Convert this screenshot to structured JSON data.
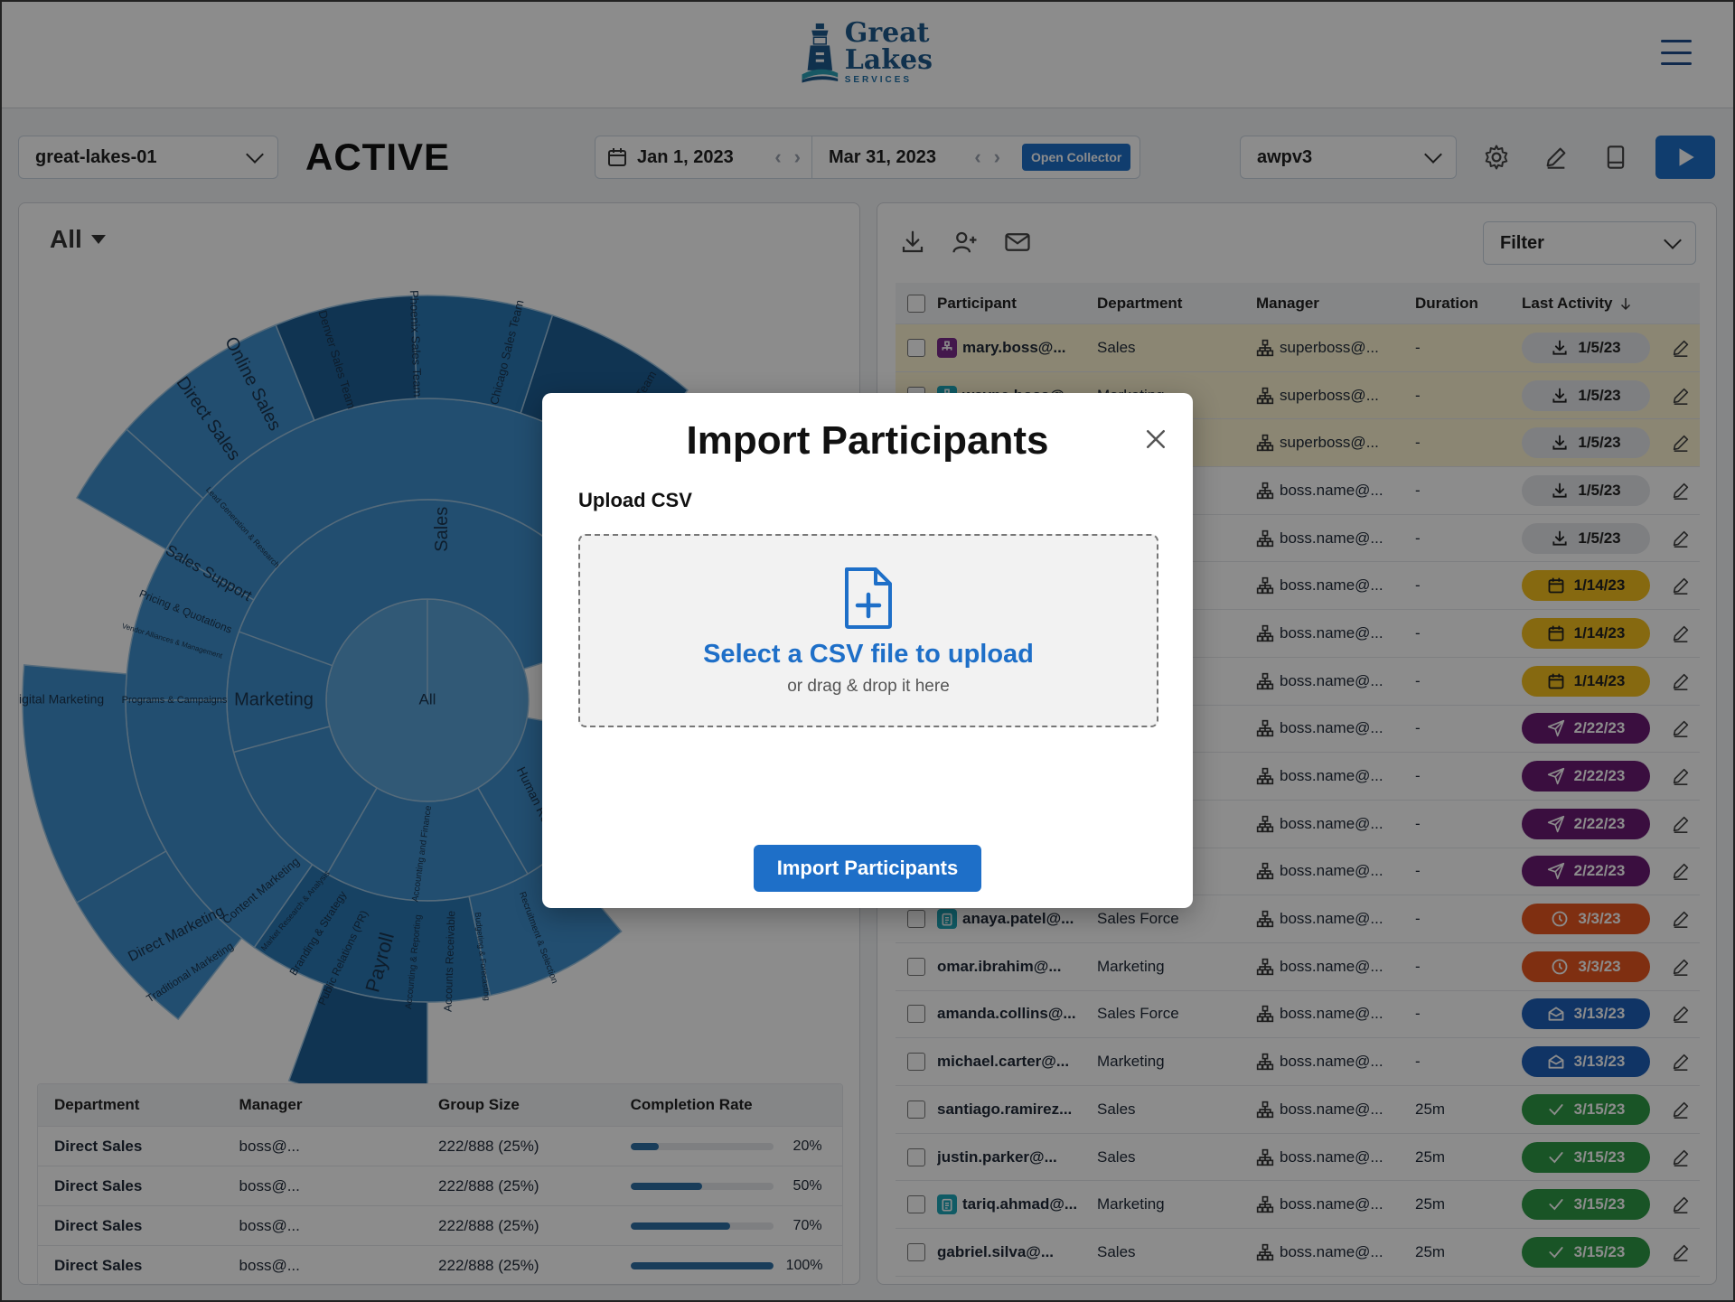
{
  "header": {
    "logo": {
      "line1": "Great",
      "line2": "Lakes",
      "line3": "SERVICES"
    }
  },
  "toolbar": {
    "site_select": "great-lakes-01",
    "status": "ACTIVE",
    "start_date": "Jan 1, 2023",
    "end_date": "Mar 31, 2023",
    "open_collector": "Open Collector",
    "survey_select": "awpv3"
  },
  "left": {
    "filter": "All",
    "sunburst_labels": {
      "center": "All",
      "sales": "Sales",
      "marketing": "Marketing",
      "direct_sales": "Direct Sales",
      "online_sales": "Online Sales",
      "denver": "Denver Sales Team",
      "phoenix": "Phoenix Sales Team",
      "chicago": "Chicago Sales Team",
      "sales_team_partial": "...les Team",
      "sales_support": "Sales Support",
      "pricing": "Pricing & Quotations",
      "vendor": "Vendor Alliances & Management",
      "lead_gen": "Lead Generation & Research",
      "digital": "Digital Marketing",
      "programs": "Programs & Campaigns",
      "direct_marketing": "Direct Marketing",
      "traditional": "Traditional Marketing",
      "content": "Content Marketing",
      "market_research": "Market Research & Analysis",
      "branding": "Branding & Strategy",
      "pr": "Public Relations (PR)",
      "payroll": "Payroll",
      "accounting": "Accounting and Finance",
      "acct_reporting": "Accounting & Reporting",
      "receivable": "Accounts Receivable",
      "budgeting": "Budgeting & Forecasting",
      "hr": "Human Resources",
      "recruitment": "Recruitment & Selection"
    },
    "table": {
      "headers": [
        "Department",
        "Manager",
        "Group Size",
        "Completion Rate"
      ],
      "rows": [
        {
          "department": "Direct Sales",
          "manager": "boss@...",
          "group": "222/888 (25%)",
          "rate": 20,
          "rate_label": "20%"
        },
        {
          "department": "Direct Sales",
          "manager": "boss@...",
          "group": "222/888 (25%)",
          "rate": 50,
          "rate_label": "50%"
        },
        {
          "department": "Direct Sales",
          "manager": "boss@...",
          "group": "222/888 (25%)",
          "rate": 70,
          "rate_label": "70%"
        },
        {
          "department": "Direct Sales",
          "manager": "boss@...",
          "group": "222/888 (25%)",
          "rate": 100,
          "rate_label": "100%"
        }
      ]
    }
  },
  "right": {
    "filter": "Filter",
    "headers": [
      "Participant",
      "Department",
      "Manager",
      "Duration",
      "Last Activity"
    ],
    "rows": [
      {
        "participant": "mary.boss@...",
        "department": "Sales",
        "manager": "superboss@...",
        "duration": "-",
        "activity": "1/5/23",
        "kind": "download",
        "badge": "org",
        "hl": true
      },
      {
        "participant": "wayne.boss@...",
        "department": "Marketing",
        "manager": "superboss@...",
        "duration": "-",
        "activity": "1/5/23",
        "kind": "download",
        "badge": "teal",
        "hl": true
      },
      {
        "participant": "",
        "department": "",
        "manager": "superboss@...",
        "duration": "-",
        "activity": "1/5/23",
        "kind": "download",
        "badge": "",
        "hl": true
      },
      {
        "participant": "",
        "department": "",
        "manager": "boss.name@...",
        "duration": "-",
        "activity": "1/5/23",
        "kind": "download",
        "badge": "",
        "hl": false
      },
      {
        "participant": "",
        "department": "",
        "manager": "boss.name@...",
        "duration": "-",
        "activity": "1/5/23",
        "kind": "download",
        "badge": "",
        "hl": false
      },
      {
        "participant": "",
        "department": "",
        "manager": "boss.name@...",
        "duration": "-",
        "activity": "1/14/23",
        "kind": "calendar",
        "badge": "",
        "hl": false
      },
      {
        "participant": "",
        "department": "",
        "manager": "boss.name@...",
        "duration": "-",
        "activity": "1/14/23",
        "kind": "calendar",
        "badge": "",
        "hl": false
      },
      {
        "participant": "",
        "department": "",
        "manager": "boss.name@...",
        "duration": "-",
        "activity": "1/14/23",
        "kind": "calendar",
        "badge": "",
        "hl": false
      },
      {
        "participant": "",
        "department": "",
        "manager": "boss.name@...",
        "duration": "-",
        "activity": "2/22/23",
        "kind": "send",
        "badge": "",
        "hl": false
      },
      {
        "participant": "",
        "department": "",
        "manager": "boss.name@...",
        "duration": "-",
        "activity": "2/22/23",
        "kind": "send",
        "badge": "",
        "hl": false
      },
      {
        "participant": "",
        "department": "",
        "manager": "boss.name@...",
        "duration": "-",
        "activity": "2/22/23",
        "kind": "send",
        "badge": "",
        "hl": false
      },
      {
        "participant": "",
        "department": "",
        "manager": "boss.name@...",
        "duration": "-",
        "activity": "2/22/23",
        "kind": "send",
        "badge": "",
        "hl": false
      },
      {
        "participant": "anaya.patel@...",
        "department": "Sales Force",
        "manager": "boss.name@...",
        "duration": "-",
        "activity": "3/3/23",
        "kind": "clock",
        "badge": "clip",
        "hl": false
      },
      {
        "participant": "omar.ibrahim@...",
        "department": "Marketing",
        "manager": "boss.name@...",
        "duration": "-",
        "activity": "3/3/23",
        "kind": "clock",
        "badge": "",
        "hl": false
      },
      {
        "participant": "amanda.collins@...",
        "department": "Sales Force",
        "manager": "boss.name@...",
        "duration": "-",
        "activity": "3/13/23",
        "kind": "mail",
        "badge": "",
        "hl": false
      },
      {
        "participant": "michael.carter@...",
        "department": "Marketing",
        "manager": "boss.name@...",
        "duration": "-",
        "activity": "3/13/23",
        "kind": "mail",
        "badge": "",
        "hl": false
      },
      {
        "participant": "santiago.ramirez...",
        "department": "Sales",
        "manager": "boss.name@...",
        "duration": "25m",
        "activity": "3/15/23",
        "kind": "check",
        "badge": "",
        "hl": false
      },
      {
        "participant": "justin.parker@...",
        "department": "Sales",
        "manager": "boss.name@...",
        "duration": "25m",
        "activity": "3/15/23",
        "kind": "check",
        "badge": "",
        "hl": false
      },
      {
        "participant": "tariq.ahmad@...",
        "department": "Marketing",
        "manager": "boss.name@...",
        "duration": "25m",
        "activity": "3/15/23",
        "kind": "check",
        "badge": "clip",
        "hl": false
      },
      {
        "participant": "gabriel.silva@...",
        "department": "Sales",
        "manager": "boss.name@...",
        "duration": "25m",
        "activity": "3/15/23",
        "kind": "check",
        "badge": "",
        "hl": false
      }
    ]
  },
  "modal": {
    "title": "Import Participants",
    "upload_label": "Upload CSV",
    "drop_main": "Select a CSV file to upload",
    "drop_sub": "or drag & drop it here",
    "submit": "Import Participants"
  },
  "colors": {
    "accent": "#1e6fc8",
    "brand": "#1e5a8c"
  }
}
